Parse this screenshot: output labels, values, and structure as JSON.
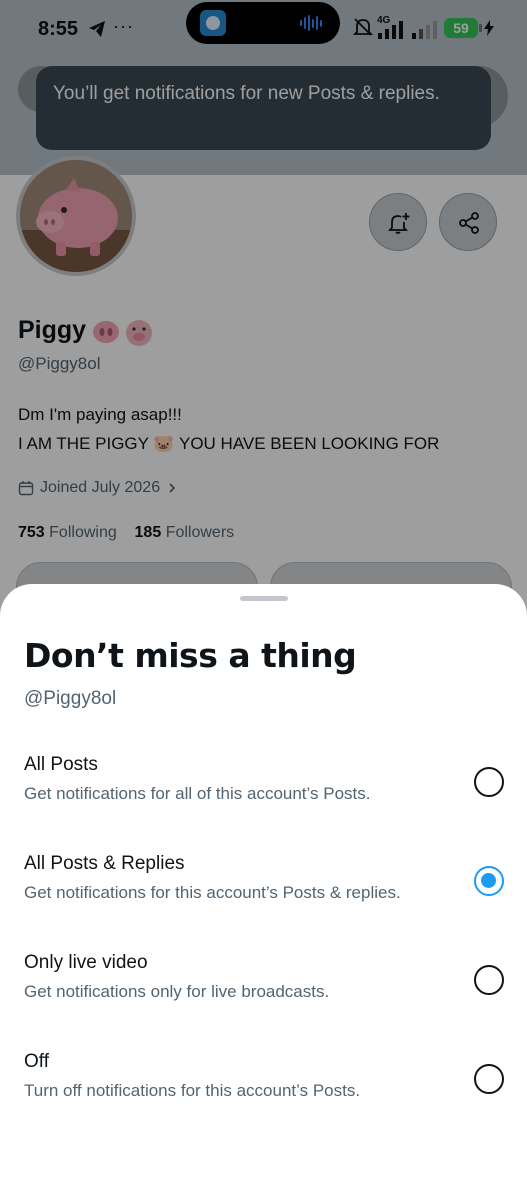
{
  "status_bar": {
    "time": "8:55",
    "more": "···",
    "network": "4G",
    "battery": "59"
  },
  "toast": {
    "message": "You’ll get notifications for new Posts & replies."
  },
  "profile": {
    "name": "Piggy",
    "handle": "@Piggy8ol",
    "bio_line1": "Dm I'm paying asap!!!",
    "bio_line2": "I AM THE PIGGY 🐷 YOU HAVE BEEN LOOKING FOR",
    "joined": "Joined July 2026",
    "following_count": "753",
    "following_label": "Following",
    "followers_count": "185",
    "followers_label": "Followers"
  },
  "sheet": {
    "title": "Don’t miss a thing",
    "handle": "@Piggy8ol",
    "options": [
      {
        "title": "All Posts",
        "subtitle": "Get notifications for all of this account’s Posts.",
        "selected": false
      },
      {
        "title": "All Posts & Replies",
        "subtitle": "Get notifications for this account’s Posts & replies.",
        "selected": true
      },
      {
        "title": "Only live video",
        "subtitle": "Get notifications only for live broadcasts.",
        "selected": false
      },
      {
        "title": "Off",
        "subtitle": "Turn off notifications for this account’s Posts.",
        "selected": false
      }
    ]
  },
  "colors": {
    "accent": "#1d9bf0",
    "secondary_text": "#536471",
    "battery": "#34c759"
  }
}
